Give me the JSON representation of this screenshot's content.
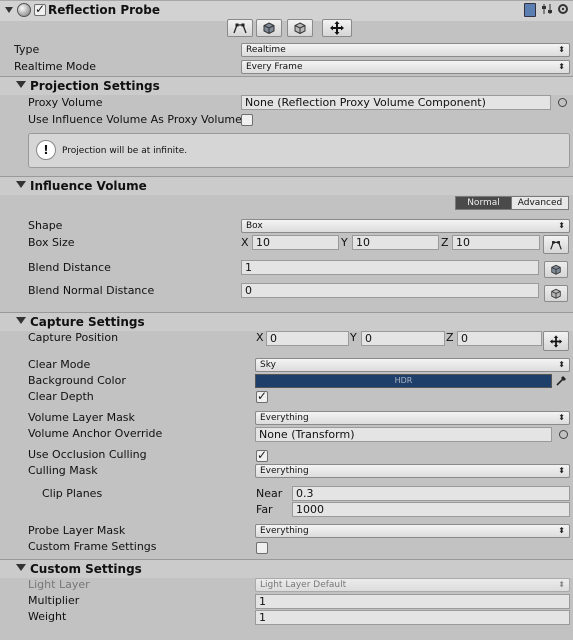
{
  "component": {
    "title": "Reflection Probe",
    "enabled": true
  },
  "toolbar": {
    "buttons": [
      "influence-volume-edit-icon",
      "projection-box-edit-icon",
      "blend-normal-edit-icon",
      "move-tool-icon"
    ]
  },
  "general": {
    "type_label": "Type",
    "type_value": "Realtime",
    "realtime_mode_label": "Realtime Mode",
    "realtime_mode_value": "Every Frame"
  },
  "projection": {
    "title": "Projection Settings",
    "proxy_volume_label": "Proxy Volume",
    "proxy_volume_value": "None (Reflection Proxy Volume Component)",
    "use_influence_label": "Use Influence Volume As Proxy Volume",
    "use_influence_checked": false,
    "info_text": "Projection will be at infinite."
  },
  "influence": {
    "title": "Influence Volume",
    "mode_normal": "Normal",
    "mode_advanced": "Advanced",
    "active_mode": "Normal",
    "shape_label": "Shape",
    "shape_value": "Box",
    "box_size_label": "Box Size",
    "axis_x": "X",
    "axis_y": "Y",
    "axis_z": "Z",
    "box_x": "10",
    "box_y": "10",
    "box_z": "10",
    "blend_distance_label": "Blend Distance",
    "blend_distance_value": "1",
    "blend_normal_label": "Blend Normal Distance",
    "blend_normal_value": "0"
  },
  "capture": {
    "title": "Capture Settings",
    "capture_position_label": "Capture Position",
    "axis_x": "X",
    "axis_y": "Y",
    "axis_z": "Z",
    "pos_x": "0",
    "pos_y": "0",
    "pos_z": "0",
    "clear_mode_label": "Clear Mode",
    "clear_mode_value": "Sky",
    "background_color_label": "Background Color",
    "background_color": "#1f3f6b",
    "hdr_text": "HDR",
    "clear_depth_label": "Clear Depth",
    "clear_depth_checked": true,
    "volume_layer_mask_label": "Volume Layer Mask",
    "volume_layer_mask_value": "Everything",
    "volume_anchor_label": "Volume Anchor Override",
    "volume_anchor_value": "None (Transform)",
    "occlusion_label": "Use Occlusion Culling",
    "occlusion_checked": true,
    "culling_mask_label": "Culling Mask",
    "culling_mask_value": "Everything",
    "clip_planes_label": "Clip Planes",
    "near_label": "Near",
    "near_value": "0.3",
    "far_label": "Far",
    "far_value": "1000",
    "probe_layer_mask_label": "Probe Layer Mask",
    "probe_layer_mask_value": "Everything",
    "custom_frame_label": "Custom Frame Settings",
    "custom_frame_checked": false
  },
  "custom": {
    "title": "Custom Settings",
    "light_layer_label": "Light Layer",
    "light_layer_value": "Light Layer Default",
    "multiplier_label": "Multiplier",
    "multiplier_value": "1",
    "weight_label": "Weight",
    "weight_value": "1"
  }
}
